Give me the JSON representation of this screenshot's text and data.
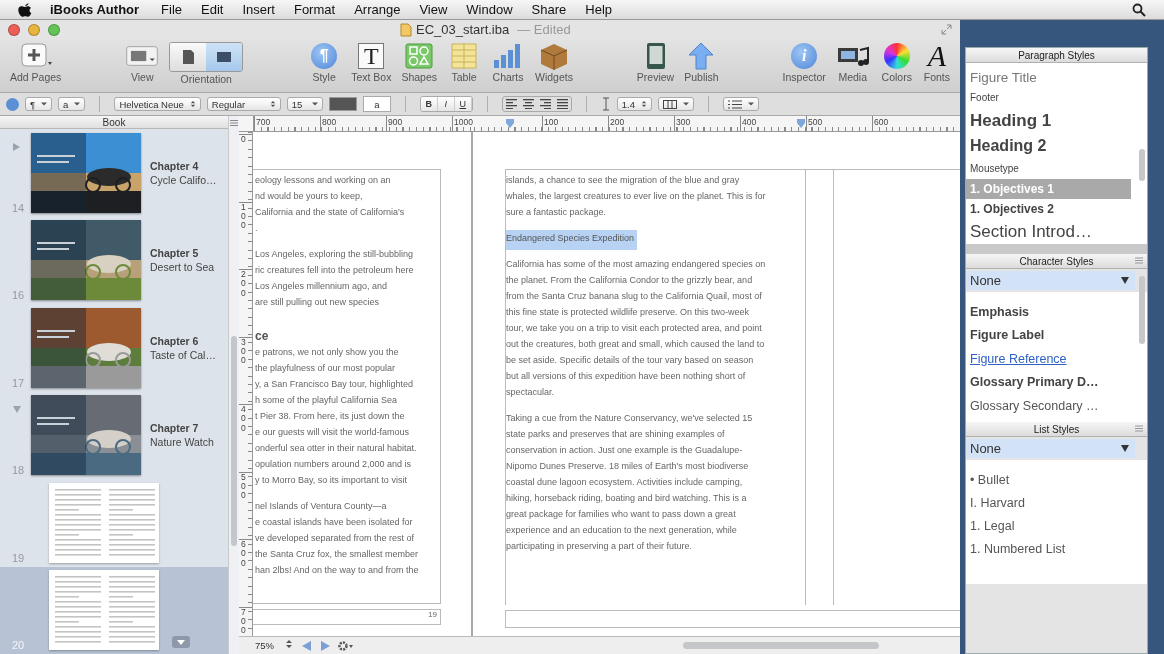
{
  "menu_bar": {
    "app": "iBooks Author",
    "menus": [
      "File",
      "Edit",
      "Insert",
      "Format",
      "Arrange",
      "View",
      "Window",
      "Share",
      "Help"
    ]
  },
  "window": {
    "title": "EC_03_start.iba",
    "status": "— Edited"
  },
  "toolbar": {
    "groups": [
      [
        {
          "kind": "add",
          "label": "Add Pages"
        }
      ],
      [
        {
          "kind": "view",
          "label": "View"
        },
        {
          "kind": "orientation",
          "label": "Orientation",
          "segments": [
            {
              "selected": false
            },
            {
              "selected": true
            }
          ]
        }
      ],
      [
        {
          "kind": "style",
          "label": "Style",
          "glyph": "¶"
        },
        {
          "kind": "textbox",
          "label": "Text Box",
          "glyph": "T"
        },
        {
          "kind": "shapes",
          "label": "Shapes"
        },
        {
          "kind": "table",
          "label": "Table"
        },
        {
          "kind": "charts",
          "label": "Charts"
        },
        {
          "kind": "widgets",
          "label": "Widgets"
        }
      ],
      [
        {
          "kind": "preview",
          "label": "Preview"
        },
        {
          "kind": "publish",
          "label": "Publish"
        }
      ],
      [
        {
          "kind": "inspector",
          "label": "Inspector",
          "glyph": "i"
        },
        {
          "kind": "media",
          "label": "Media"
        },
        {
          "kind": "colors",
          "label": "Colors"
        },
        {
          "kind": "fonts",
          "label": "Fonts",
          "glyph": "A"
        }
      ]
    ]
  },
  "format_bar": {
    "controls": [
      {
        "kind": "circle-icon"
      },
      {
        "kind": "popup",
        "text": "¶"
      },
      {
        "kind": "popup",
        "text": "a"
      },
      {
        "kind": "separator"
      },
      {
        "kind": "stepper",
        "text": "Helvetica Neue"
      },
      {
        "kind": "stepper",
        "text": "Regular"
      },
      {
        "kind": "combo",
        "text": "15"
      },
      {
        "kind": "color-well"
      },
      {
        "kind": "field",
        "text": "a"
      },
      {
        "kind": "separator"
      },
      {
        "kind": "segmented",
        "items": [
          "B",
          "I",
          "U"
        ]
      },
      {
        "kind": "separator"
      },
      {
        "kind": "align-group"
      },
      {
        "kind": "separator"
      },
      {
        "kind": "spacing-icon"
      },
      {
        "kind": "stepper",
        "text": "1.4"
      },
      {
        "kind": "columns-popup"
      },
      {
        "kind": "separator"
      },
      {
        "kind": "list-popup"
      }
    ]
  },
  "sidebar": {
    "title": "Book",
    "items": [
      {
        "kind": "chapter",
        "page": "14",
        "title": "Chapter 4",
        "subtitle": "Cycle Califo…",
        "expanded": false,
        "selected": false
      },
      {
        "kind": "chapter",
        "page": "16",
        "title": "Chapter 5",
        "subtitle": "Desert to Sea",
        "selected": false
      },
      {
        "kind": "chapter",
        "page": "17",
        "title": "Chapter 6",
        "subtitle": "Taste of Cal…",
        "selected": false
      },
      {
        "kind": "chapter",
        "page": "18",
        "title": "Chapter 7",
        "subtitle": "Nature Watch",
        "expanded": true,
        "selected": false
      },
      {
        "kind": "page",
        "page": "19",
        "selected": false
      },
      {
        "kind": "page",
        "page": "20",
        "selected": true
      }
    ]
  },
  "rulers": {
    "left_page": [
      "700",
      "800",
      "900",
      "1000"
    ],
    "right_page": [
      "100",
      "200",
      "300",
      "400",
      "500",
      "600"
    ],
    "vertical": [
      "0",
      "100",
      "200",
      "300",
      "400",
      "500",
      "600",
      "700"
    ]
  },
  "left_page": {
    "blocks": [
      {
        "kind": "text",
        "lines": [
          "eology lessons and working on an",
          "nd would be yours to keep,",
          "California and the state of California's",
          "."
        ]
      },
      {
        "kind": "text",
        "lines": [
          "Los Angeles, exploring the still-bubbling",
          "ric creatures fell into the petroleum here",
          "Los Angeles millennium ago, and",
          "are still pulling out new species"
        ]
      },
      {
        "kind": "heading",
        "text": "ce",
        "selected": false
      },
      {
        "kind": "text",
        "lines": [
          "e patrons, we not only show you the",
          "the playfulness of our most popular",
          "y, a San Francisco Bay tour, highlighted",
          "h some of the playful California Sea",
          "t Pier 38. From here, its just down the",
          "e our guests will visit the world-famous",
          "onderful sea otter in their natural habitat.",
          "opulation numbers around 2,000 and is",
          "y to Morro Bay, so its important to visit"
        ]
      },
      {
        "kind": "text",
        "lines": [
          "nel Islands of Ventura County—a",
          "e coastal islands have been isolated for",
          "ve developed separated from the rest of",
          "the Santa Cruz fox, the smallest member",
          "han 2lbs! And on the way to and from the"
        ]
      }
    ],
    "footer": "19"
  },
  "right_page": {
    "blocks": [
      {
        "kind": "text",
        "lines": [
          "islands, a chance to see the migration of the blue and gray",
          "whales, the largest creatures to ever live on the planet. This is for",
          "sure a fantastic package."
        ]
      },
      {
        "kind": "heading",
        "text": "Endangered Species Expedition",
        "selected": true
      },
      {
        "kind": "text",
        "lines": [
          "California has some of the most amazing endangered species on",
          "the planet. From the California Condor to the grizzly bear, and",
          "from the Santa Cruz banana slug to the California Quail, most of",
          "this fine state is protected wildlife preserve. On this two-week",
          "tour, we take you on a trip to visit each protected area, and point",
          "out the creatures, both great and small, which caused the land to",
          "be set aside. Specific details of the tour vary based on season",
          "but all versions of this expedition have been nothing short of",
          "spectacular."
        ]
      },
      {
        "kind": "text",
        "lines": [
          "Taking a cue from the Nature Conservancy, we've selected 15",
          "state parks and preserves that are shining examples of",
          "conservation in action. Just one example is the Guadalupe-",
          "Nipomo Dunes Preserve. 18 miles of Earth's most biodiverse",
          "coastal dune lagoon ecosystem. Activities include camping,",
          "hiking, horseback riding, boating and bird watching. This is a",
          "great package for families who want to pass down a great",
          "experience and an education to the next generation, while",
          "participating in preserving a part of their future."
        ]
      }
    ]
  },
  "bottom_bar": {
    "zoom": "75%"
  },
  "styles_panel": {
    "paragraph_styles": {
      "title": "Paragraph Styles",
      "items": [
        {
          "kind": "title",
          "label": "Figure Title",
          "selected": false
        },
        {
          "kind": "small",
          "label": "Footer",
          "selected": false
        },
        {
          "kind": "heading",
          "label": "Heading 1",
          "selected": false
        },
        {
          "kind": "heading-2",
          "label": "Heading 2",
          "selected": false
        },
        {
          "kind": "small",
          "label": "Mousetype",
          "selected": false
        },
        {
          "kind": "numbered",
          "label": "1. Objectives 1",
          "selected": true
        },
        {
          "kind": "numbered",
          "label": "1. Objectives 2",
          "selected": false
        },
        {
          "kind": "intro",
          "label": "Section Introd…",
          "selected": false
        }
      ]
    },
    "character_styles": {
      "title": "Character Styles",
      "current": "None",
      "items": [
        {
          "kind": "bold",
          "label": "Emphasis"
        },
        {
          "kind": "bold",
          "label": "Figure Label"
        },
        {
          "kind": "link",
          "label": "Figure Reference"
        },
        {
          "kind": "bold",
          "label": "Glossary Primary D…"
        },
        {
          "kind": "plain",
          "label": "Glossary Secondary …"
        }
      ]
    },
    "list_styles": {
      "title": "List Styles",
      "current": "None",
      "items": [
        {
          "kind": "plain",
          "label": "• Bullet"
        },
        {
          "kind": "plain",
          "label": "I. Harvard"
        },
        {
          "kind": "plain",
          "label": "1. Legal"
        },
        {
          "kind": "plain",
          "label": "1. Numbered List"
        }
      ]
    }
  }
}
